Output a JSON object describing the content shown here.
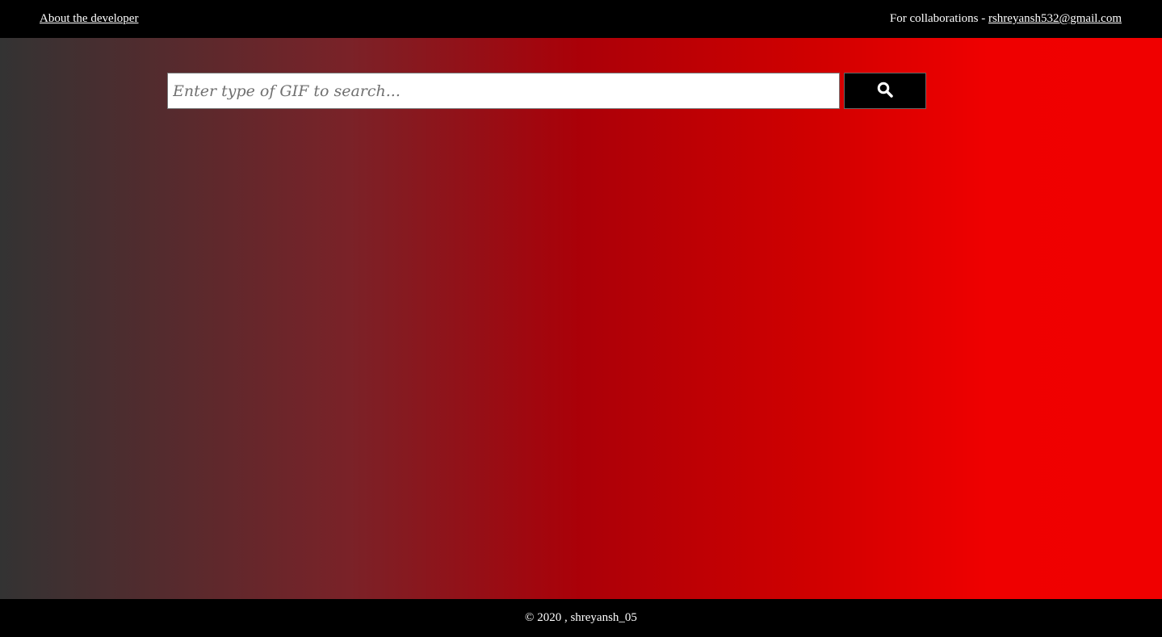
{
  "header": {
    "about_link": "About the developer",
    "collab_text": "For collaborations - ",
    "email_link": "rshreyansh532@gmail.com"
  },
  "search": {
    "placeholder": "Enter type of GIF to search...",
    "value": "",
    "button_icon": "search-icon"
  },
  "footer": {
    "copyright": "© 2020 , shreyansh_05"
  },
  "colors": {
    "header_bg": "#000000",
    "footer_bg": "#000000",
    "gradient_start": "#333333",
    "gradient_mid": "#ab0008",
    "gradient_end": "#f00000"
  }
}
